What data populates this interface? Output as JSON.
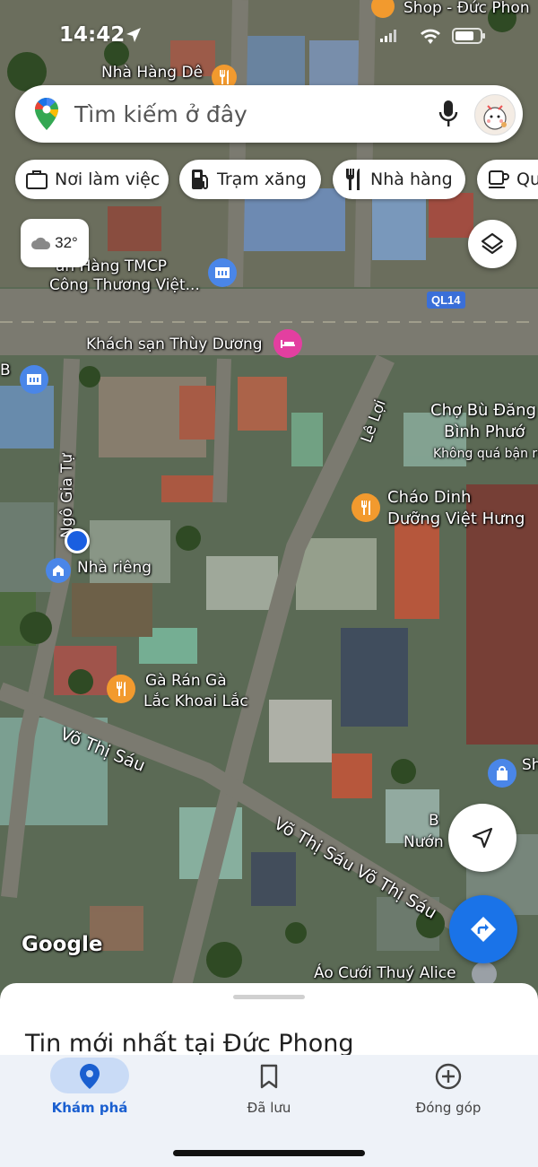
{
  "status_bar": {
    "time": "14:42"
  },
  "search": {
    "placeholder": "Tìm kiếm ở đây"
  },
  "chips": [
    {
      "label": "Nơi làm việc",
      "icon": "briefcase-icon"
    },
    {
      "label": "Trạm xăng",
      "icon": "gas-station-icon"
    },
    {
      "label": "Nhà hàng",
      "icon": "restaurant-icon"
    },
    {
      "label": "Qu",
      "icon": "coffee-icon"
    }
  ],
  "weather": {
    "temp": "32°",
    "icon": "cloud-icon"
  },
  "map": {
    "labels": {
      "shop_top": "Shop - Đức Phon",
      "nha_hang_de": "Nhà Hàng Dê",
      "bank_1": "ân Hàng TMCP",
      "bank_2": "Công Thương Việt...",
      "route": "QL14",
      "hotel": "Khách sạn Thùy Dương",
      "b_left": "B",
      "ngo_gia_tu": "Ngô Gia Tự",
      "le_loi": "Lê Lợi",
      "cho_1": "Chợ Bù Đăng",
      "cho_2": "Bình Phướ",
      "cho_3": "Không quá bận rộ",
      "chao_1": "Cháo Dinh",
      "chao_2": "Dưỡng Việt Hưng",
      "nha_rieng": "Nhà riêng",
      "ga_1": "Gà Rán Gà",
      "ga_2": "Lắc Khoai Lắc",
      "vo_thi_sau_1": "Võ Thị Sáu",
      "vo_thi_sau_2": "Võ Thị Sáu Võ Thị Sáu",
      "nuong_1": "B",
      "nuong_2": "Nướn",
      "sh": "Sh",
      "ao_cuoi": "Áo Cưới Thuý Alice",
      "google": "Google"
    },
    "colors": {
      "road": "#7b7a70",
      "route_badge": "#3a6fd8",
      "restaurant_pin": "#f29a2e",
      "hotel_pin": "#e33fa0",
      "bank_pin": "#4a86e8",
      "location_dot": "#1a5fe0"
    }
  },
  "sheet": {
    "title": "Tin mới nhất tại Đức Phong"
  },
  "nav": [
    {
      "label": "Khám phá",
      "icon": "location-pin-icon",
      "active": true
    },
    {
      "label": "Đã lưu",
      "icon": "bookmark-icon",
      "active": false
    },
    {
      "label": "Đóng góp",
      "icon": "plus-circle-icon",
      "active": false
    }
  ]
}
